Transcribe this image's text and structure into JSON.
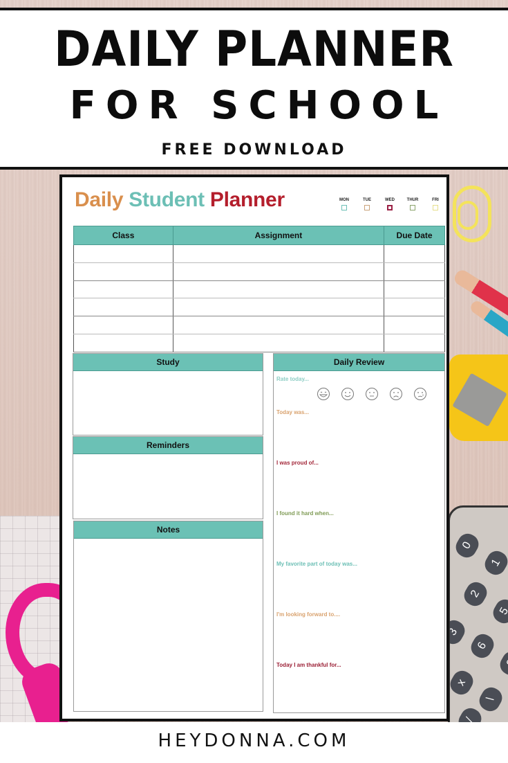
{
  "header": {
    "title_line1": "DAILY PLANNER",
    "title_line2": "FOR SCHOOL",
    "subtitle": "FREE DOWNLOAD"
  },
  "planner": {
    "title_parts": [
      "Daily",
      "Student",
      "Planner"
    ],
    "title_colors": [
      "#d98f4d",
      "#6cbfb5",
      "#b41e2c"
    ],
    "days": [
      {
        "label": "MON",
        "color": "#6cbfb5"
      },
      {
        "label": "TUE",
        "color": "#c9a27a"
      },
      {
        "label": "WED",
        "color": "#9b2145"
      },
      {
        "label": "THUR",
        "color": "#8aa36b"
      },
      {
        "label": "FRI",
        "color": "#e6df8c"
      }
    ],
    "table": {
      "headers": [
        "Class",
        "Assignment",
        "Due Date"
      ],
      "row_count": 6
    },
    "sections": {
      "study": "Study",
      "reminders": "Reminders",
      "notes": "Notes",
      "daily_review": "Daily Review"
    },
    "rate_label": "Rate today...",
    "rating_faces": [
      "laughing-face",
      "smiling-face",
      "neutral-face",
      "sad-face",
      "crying-face"
    ],
    "review_prompts": [
      {
        "text": "Today was...",
        "color": "#d9a26e"
      },
      {
        "text": "I was proud of...",
        "color": "#a3283a"
      },
      {
        "text": "I found it hard when...",
        "color": "#7f9b55"
      },
      {
        "text": "My favorite part of today was...",
        "color": "#6cbfb5"
      },
      {
        "text": "I'm looking forward to....",
        "color": "#d9a26e"
      },
      {
        "text": "Today I am thankful for...",
        "color": "#9b1f35"
      }
    ],
    "accent_color": "#6bc1b5"
  },
  "calculator_keys": [
    "0",
    "1",
    "2",
    "5",
    "3",
    "6",
    "9",
    "x",
    "\\",
    "/"
  ],
  "footer": {
    "site": "HEYDONNA.COM"
  }
}
